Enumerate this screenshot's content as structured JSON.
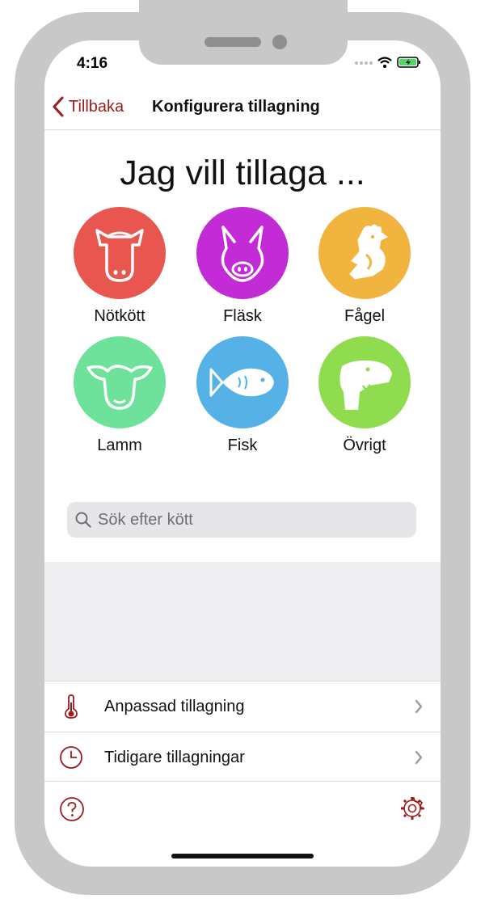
{
  "status_bar": {
    "time": "4:16"
  },
  "nav": {
    "back_label": "Tillbaka",
    "title": "Konfigurera tillagning"
  },
  "main": {
    "heading": "Jag vill tillaga ...",
    "categories": [
      {
        "label": "Nötkött",
        "color": "#e8564f",
        "icon": "cow-icon"
      },
      {
        "label": "Fläsk",
        "color": "#c22bd6",
        "icon": "pig-icon"
      },
      {
        "label": "Fågel",
        "color": "#f0b43f",
        "icon": "chicken-icon"
      },
      {
        "label": "Lamm",
        "color": "#6ee29a",
        "icon": "sheep-icon"
      },
      {
        "label": "Fisk",
        "color": "#55b1e6",
        "icon": "fish-icon"
      },
      {
        "label": "Övrigt",
        "color": "#8fdc4f",
        "icon": "dinosaur-icon"
      }
    ]
  },
  "search": {
    "placeholder": "Sök efter kött"
  },
  "menu": {
    "items": [
      {
        "label": "Anpassad tillagning",
        "icon": "thermometer-icon"
      },
      {
        "label": "Tidigare tillagningar",
        "icon": "clock-icon"
      }
    ]
  },
  "colors": {
    "accent": "#9b1c1c"
  }
}
